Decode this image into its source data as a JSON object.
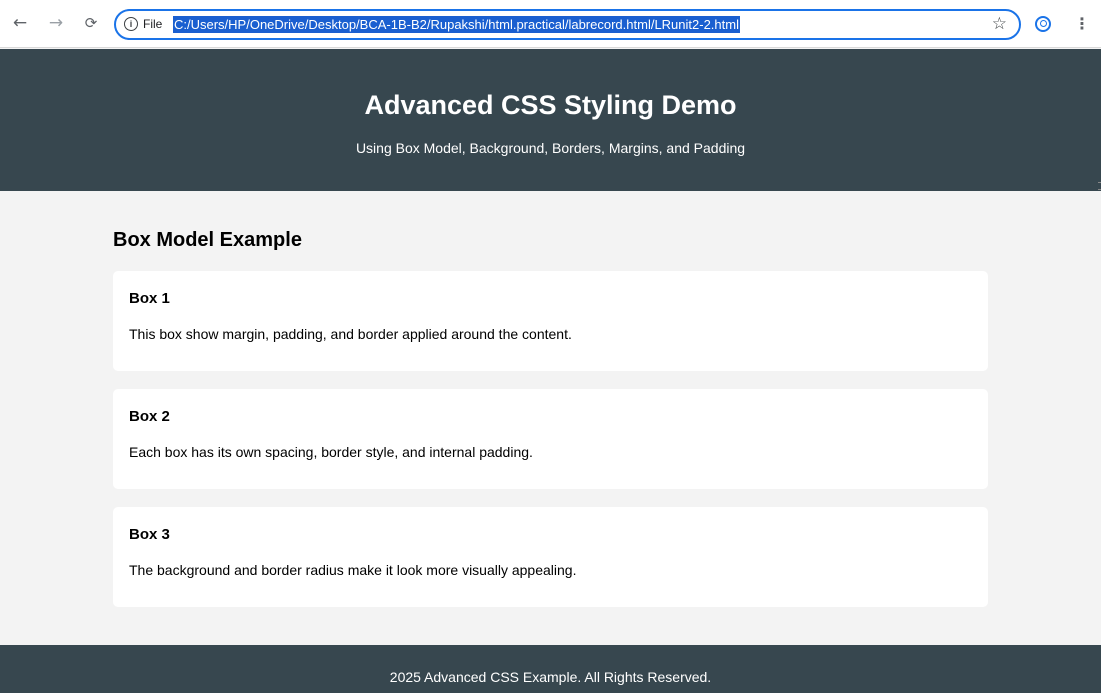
{
  "browser": {
    "back_icon": "arrow-left-icon",
    "forward_icon": "arrow-right-icon",
    "reload_icon": "reload-icon",
    "file_label": "File",
    "url": "C:/Users/HP/OneDrive/Desktop/BCA-1B-B2/Rupakshi/html.practical/labrecord.html/LRunit2-2.html",
    "accent_color": "#1a73e8"
  },
  "header": {
    "title": "Advanced CSS Styling Demo",
    "subtitle": "Using Box Model, Background, Borders, Margins, and Padding",
    "background_color": "#37474f"
  },
  "main": {
    "title": "Box Model Example",
    "boxes": [
      {
        "heading": "Box 1",
        "text": "This box show margin, padding, and border applied around the content."
      },
      {
        "heading": "Box 2",
        "text": "Each box has its own spacing, border style, and internal padding."
      },
      {
        "heading": "Box 3",
        "text": "The background and border radius make it look more visually appealing."
      }
    ]
  },
  "footer": {
    "text": "2025 Advanced CSS Example. All Rights Reserved."
  }
}
